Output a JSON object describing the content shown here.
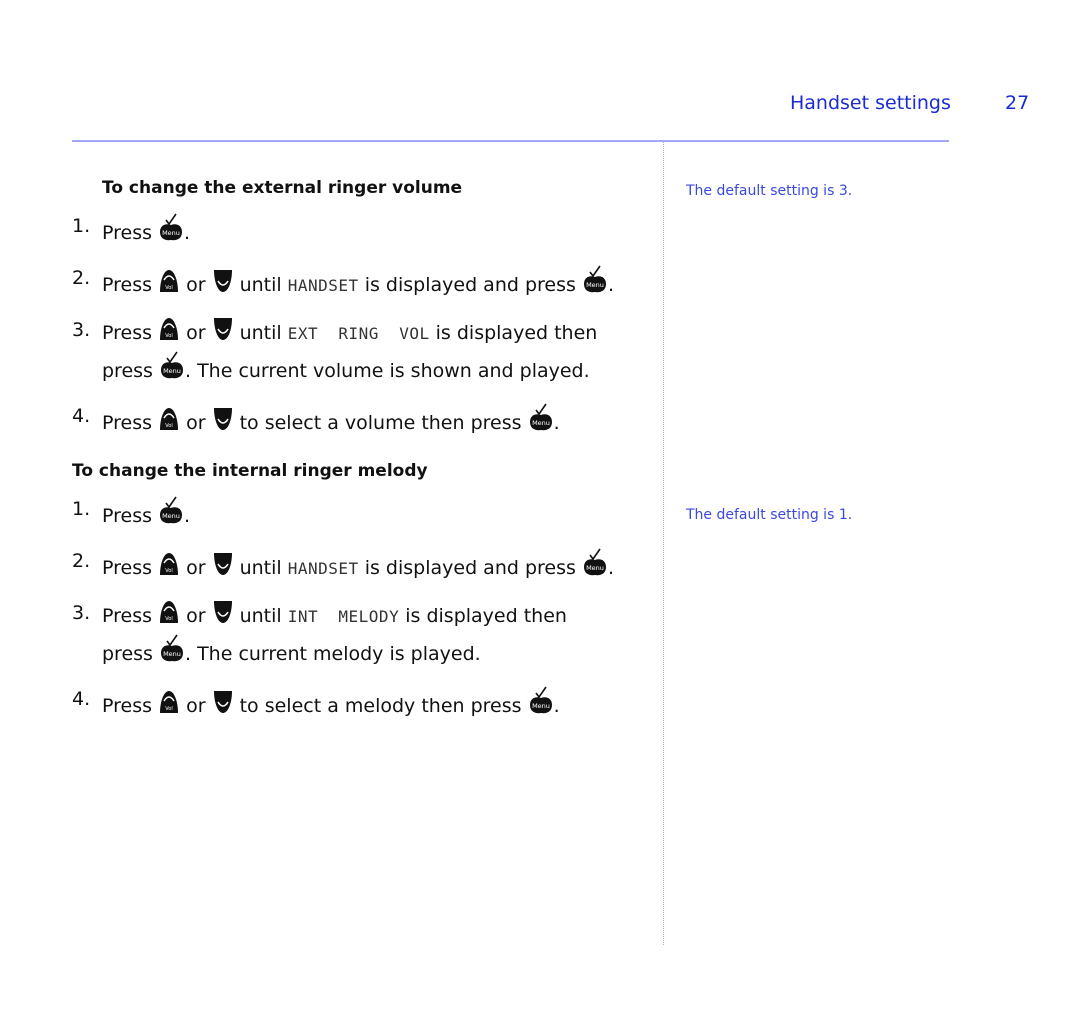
{
  "header": {
    "title": "Handset settings",
    "page_number": "27"
  },
  "sections": [
    {
      "heading": "To change the external ringer volume",
      "note": "The default setting is 3.",
      "steps": [
        {
          "num": "1.",
          "parts": [
            "Press ",
            "menu-icon",
            "."
          ]
        },
        {
          "num": "2.",
          "parts": [
            "Press ",
            "vol-up-icon",
            " or ",
            "vol-down-icon",
            " until ",
            "lcd:HANDSET",
            " is displayed and press ",
            "menu-icon",
            "."
          ]
        },
        {
          "num": "3.",
          "parts": [
            "Press ",
            "vol-up-icon",
            " or ",
            "vol-down-icon",
            " until ",
            "lcd:EXT  RING  VOL",
            " is displayed then",
            "br",
            "press ",
            "menu-icon",
            ". The current volume is shown and played."
          ]
        },
        {
          "num": "4.",
          "parts": [
            "Press ",
            "vol-up-icon",
            " or ",
            "vol-down-icon",
            " to select a volume then press ",
            "menu-icon",
            "."
          ]
        }
      ]
    },
    {
      "heading": "To change the internal ringer melody",
      "note": "The default setting is 1.",
      "steps": [
        {
          "num": "1.",
          "parts": [
            "Press ",
            "menu-icon",
            "."
          ]
        },
        {
          "num": "2.",
          "parts": [
            "Press ",
            "vol-up-icon",
            " or ",
            "vol-down-icon",
            " until ",
            "lcd:HANDSET",
            " is displayed and press ",
            "menu-icon",
            "."
          ]
        },
        {
          "num": "3.",
          "parts": [
            "Press ",
            "vol-up-icon",
            " or ",
            "vol-down-icon",
            " until ",
            "lcd:INT  MELODY",
            " is displayed then",
            "br",
            "press ",
            "menu-icon",
            ". The current melody is played."
          ]
        },
        {
          "num": "4.",
          "parts": [
            "Press ",
            "vol-up-icon",
            " or ",
            "vol-down-icon",
            " to select a melody then press ",
            "menu-icon",
            "."
          ]
        }
      ]
    }
  ],
  "icons": {
    "menu_label": "Menu",
    "vol_label": "Vol"
  },
  "colors": {
    "accent": "#1a2bd6",
    "rule": "#a5a8f5",
    "note": "#3949e0"
  }
}
